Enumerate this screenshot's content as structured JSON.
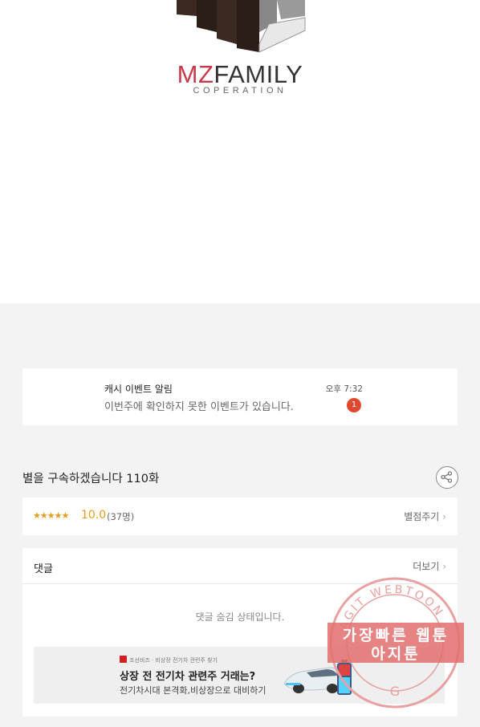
{
  "logo": {
    "mz": "MZ",
    "family": "FAMILY",
    "subtitle": "COPERATION"
  },
  "notification": {
    "title": "캐시 이벤트 알림",
    "body": "이번주에 확인하지 못한 이벤트가 있습니다.",
    "time": "오후 7:32",
    "badge": "1"
  },
  "episode": {
    "title": "별을 구속하겠습니다 110화",
    "share_icon": "share-icon"
  },
  "rating": {
    "stars": "★★★★★",
    "score": "10.0",
    "count": "(37명)",
    "rate_link": "별점주기"
  },
  "comments": {
    "title": "댓글",
    "more_link": "더보기",
    "hidden_message": "댓글 숨김 상태입니다."
  },
  "ad": {
    "small_text": "조선비즈 · 비상장 전기차 관련주 찾기",
    "headline": "상장 전 전기차 관련주 거래는?",
    "subtext": "전기차시대 본격화,비상장으로 대비하기"
  },
  "watermark": {
    "ring_text": "AGIT WEBTOON",
    "line1": "가장빠른 웹툰",
    "line2": "아지툰"
  },
  "colors": {
    "accent_orange": "#e79d1a",
    "badge_red": "#e0492f",
    "logo_red": "#c8384a",
    "watermark_red": "#e26e6e"
  }
}
